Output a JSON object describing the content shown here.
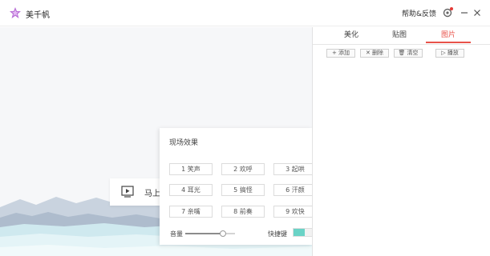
{
  "app": {
    "title": "美千帆",
    "help_link": "帮助&反馈",
    "logo_icon": "star-logo-icon",
    "accent": "#e8524a"
  },
  "stage": {
    "start_label": "马上"
  },
  "right_panel": {
    "tabs": [
      {
        "label": "美化",
        "active": false
      },
      {
        "label": "贴图",
        "active": false
      },
      {
        "label": "图片",
        "active": true
      }
    ],
    "toolbar": [
      {
        "icon": "plus-icon",
        "label": "+ 添加"
      },
      {
        "icon": "x-icon",
        "label": "✕ 删除"
      },
      {
        "icon": "trash-icon",
        "label": "🗑 清空"
      },
      {
        "icon": "play-icon",
        "label": "▷ 播放"
      }
    ]
  },
  "effects": {
    "title": "现场效果",
    "buttons": [
      {
        "label": "1  笑声"
      },
      {
        "label": "2  欢呼"
      },
      {
        "label": "3  起哄"
      },
      {
        "label": "4  耳光"
      },
      {
        "label": "5  搞怪"
      },
      {
        "label": "6  汗颜"
      },
      {
        "label": "7  亲嘴"
      },
      {
        "label": "8  前奏"
      },
      {
        "label": "9  欢快"
      }
    ],
    "volume_label": "音量",
    "volume_level": 0.75,
    "shortcut_label": "快捷键",
    "shortcut_enabled": true,
    "toggle_color": "#6ad3c6"
  }
}
